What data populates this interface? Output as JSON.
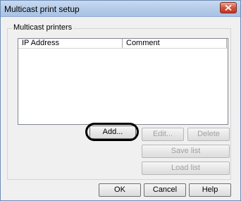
{
  "window": {
    "title": "Multicast print setup"
  },
  "group": {
    "label": "Multicast printers"
  },
  "list": {
    "columns": [
      "IP Address",
      "Comment"
    ],
    "rows": []
  },
  "buttons": {
    "add": "Add...",
    "edit": "Edit...",
    "delete": "Delete",
    "save_list": "Save list",
    "load_list": "Load list",
    "ok": "OK",
    "cancel": "Cancel",
    "help": "Help"
  },
  "colors": {
    "title_bar": "#b7cde9",
    "close_button": "#d3533b",
    "highlight_ring": "#000000"
  },
  "icons": {
    "close": "close-icon"
  }
}
